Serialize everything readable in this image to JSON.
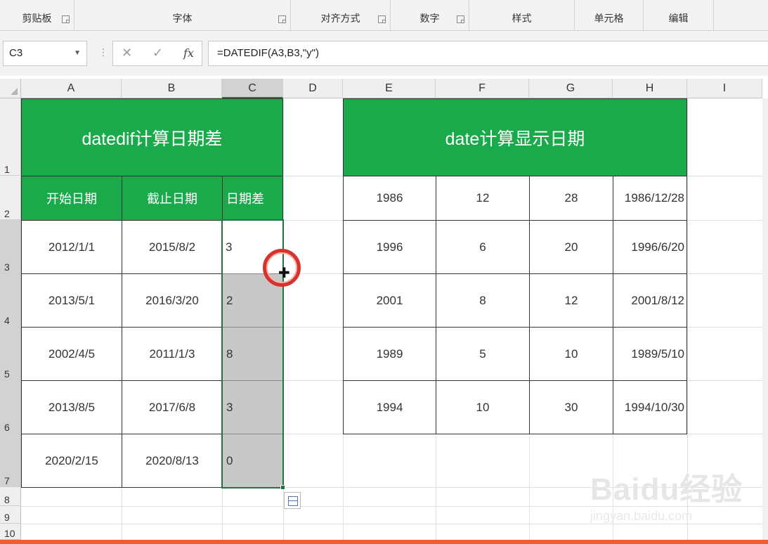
{
  "ribbon": {
    "groups": [
      {
        "label": "剪贴板"
      },
      {
        "label": "字体"
      },
      {
        "label": "对齐方式"
      },
      {
        "label": "数字"
      },
      {
        "label": "样式"
      },
      {
        "label": "单元格"
      },
      {
        "label": "编辑"
      }
    ]
  },
  "formula_bar": {
    "name_box": "C3",
    "cancel": "✕",
    "enter": "✓",
    "fx": "fx",
    "formula": "=DATEDIF(A3,B3,\"y\")"
  },
  "columns": [
    "A",
    "B",
    "C",
    "D",
    "E",
    "F",
    "G",
    "H",
    "I"
  ],
  "rows": [
    "1",
    "2",
    "3",
    "4",
    "5",
    "6",
    "7",
    "8",
    "9",
    "10"
  ],
  "table1": {
    "title": "datedif计算日期差",
    "headers": [
      "开始日期",
      "截止日期",
      "日期差"
    ],
    "rows": [
      [
        "2012/1/1",
        "2015/8/2",
        "3"
      ],
      [
        "2013/5/1",
        "2016/3/20",
        "2"
      ],
      [
        "2002/4/5",
        "2011/1/3",
        "8"
      ],
      [
        "2013/8/5",
        "2017/6/8",
        "3"
      ],
      [
        "2020/2/15",
        "2020/8/13",
        "0"
      ]
    ]
  },
  "table2": {
    "title": "date计算显示日期",
    "rows": [
      [
        "1986",
        "12",
        "28",
        "1986/12/28"
      ],
      [
        "1996",
        "6",
        "20",
        "1996/6/20"
      ],
      [
        "2001",
        "8",
        "12",
        "2001/8/12"
      ],
      [
        "1989",
        "5",
        "10",
        "1989/5/10"
      ],
      [
        "1994",
        "10",
        "30",
        "1994/10/30"
      ]
    ]
  },
  "watermark": {
    "logo": "Baidu经验",
    "url": "jingyan.baidu.com"
  },
  "colors": {
    "header_green": "#1aaa4b",
    "selection": "#217346",
    "cursor_ring": "#d8322f"
  }
}
